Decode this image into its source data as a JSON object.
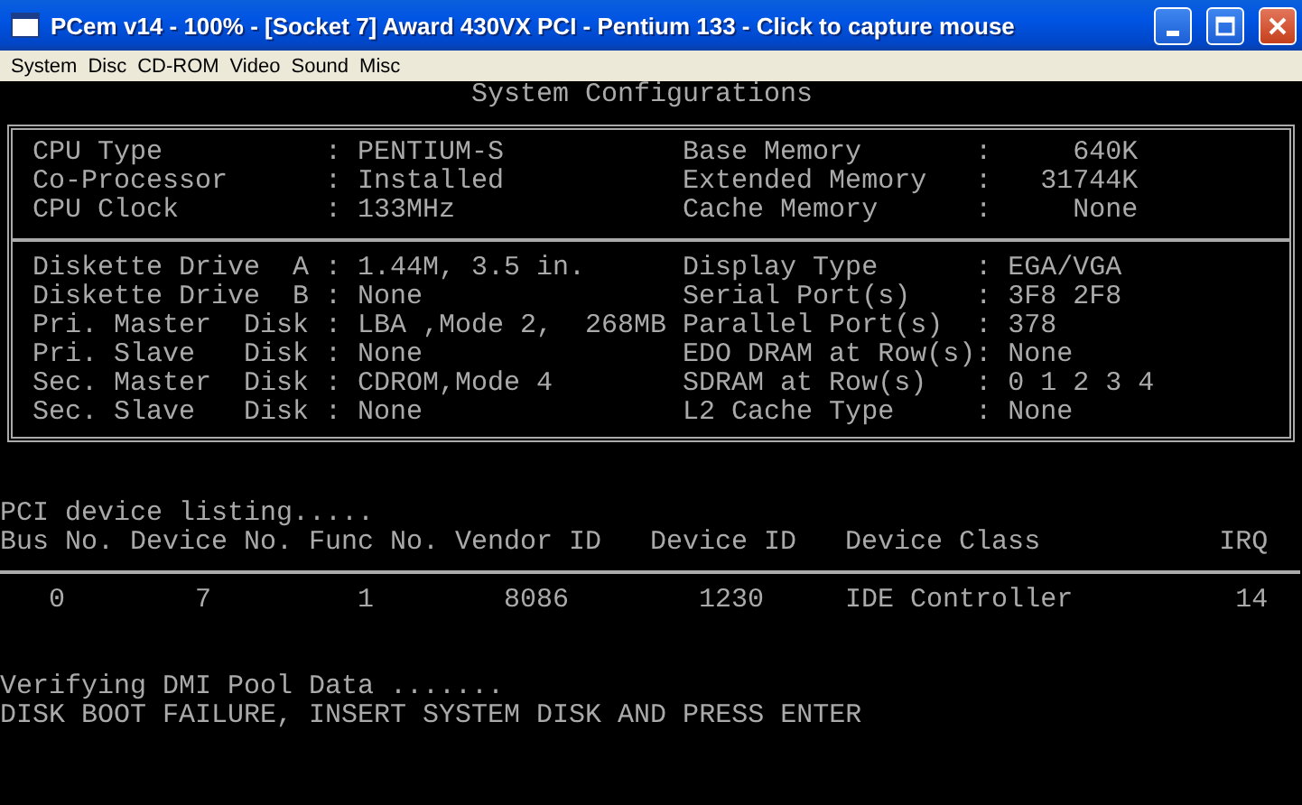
{
  "window": {
    "title": "PCem v14 - 100% - [Socket 7] Award 430VX PCI - Pentium 133 - Click to capture mouse"
  },
  "menu": [
    "System",
    "Disc",
    "CD-ROM",
    "Video",
    "Sound",
    "Misc"
  ],
  "screen": {
    "heading": "System Configurations",
    "sections": [
      {
        "rows": [
          {
            "left": "CPU Type          : PENTIUM-S",
            "right": "Base Memory       :     640K"
          },
          {
            "left": "Co-Processor      : Installed",
            "right": "Extended Memory   :   31744K"
          },
          {
            "left": "CPU Clock         : 133MHz",
            "right": "Cache Memory      :     None"
          }
        ]
      },
      {
        "rows": [
          {
            "left": "Diskette Drive  A : 1.44M, 3.5 in.",
            "right": "Display Type      : EGA/VGA"
          },
          {
            "left": "Diskette Drive  B : None",
            "right": "Serial Port(s)    : 3F8 2F8"
          },
          {
            "left": "Pri. Master  Disk : LBA ,Mode 2,  268MB",
            "right": "Parallel Port(s)  : 378"
          },
          {
            "left": "Pri. Slave   Disk : None",
            "right": "EDO DRAM at Row(s): None"
          },
          {
            "left": "Sec. Master  Disk : CDROM,Mode 4",
            "right": "SDRAM at Row(s)   : 0 1 2 3 4"
          },
          {
            "left": "Sec. Slave   Disk : None",
            "right": "L2 Cache Type     : None"
          }
        ]
      }
    ],
    "pci_title": "PCI device listing.....",
    "pci_columns": [
      "Bus No.",
      "Device No.",
      "Func No.",
      "Vendor ID",
      "Device ID",
      "Device Class",
      "IRQ"
    ],
    "pci_rows": [
      [
        "0",
        "7",
        "1",
        "8086",
        "1230",
        "IDE Controller",
        "14"
      ]
    ],
    "messages": [
      "Verifying DMI Pool Data .......",
      "DISK BOOT FAILURE, INSERT SYSTEM DISK AND PRESS ENTER"
    ]
  }
}
